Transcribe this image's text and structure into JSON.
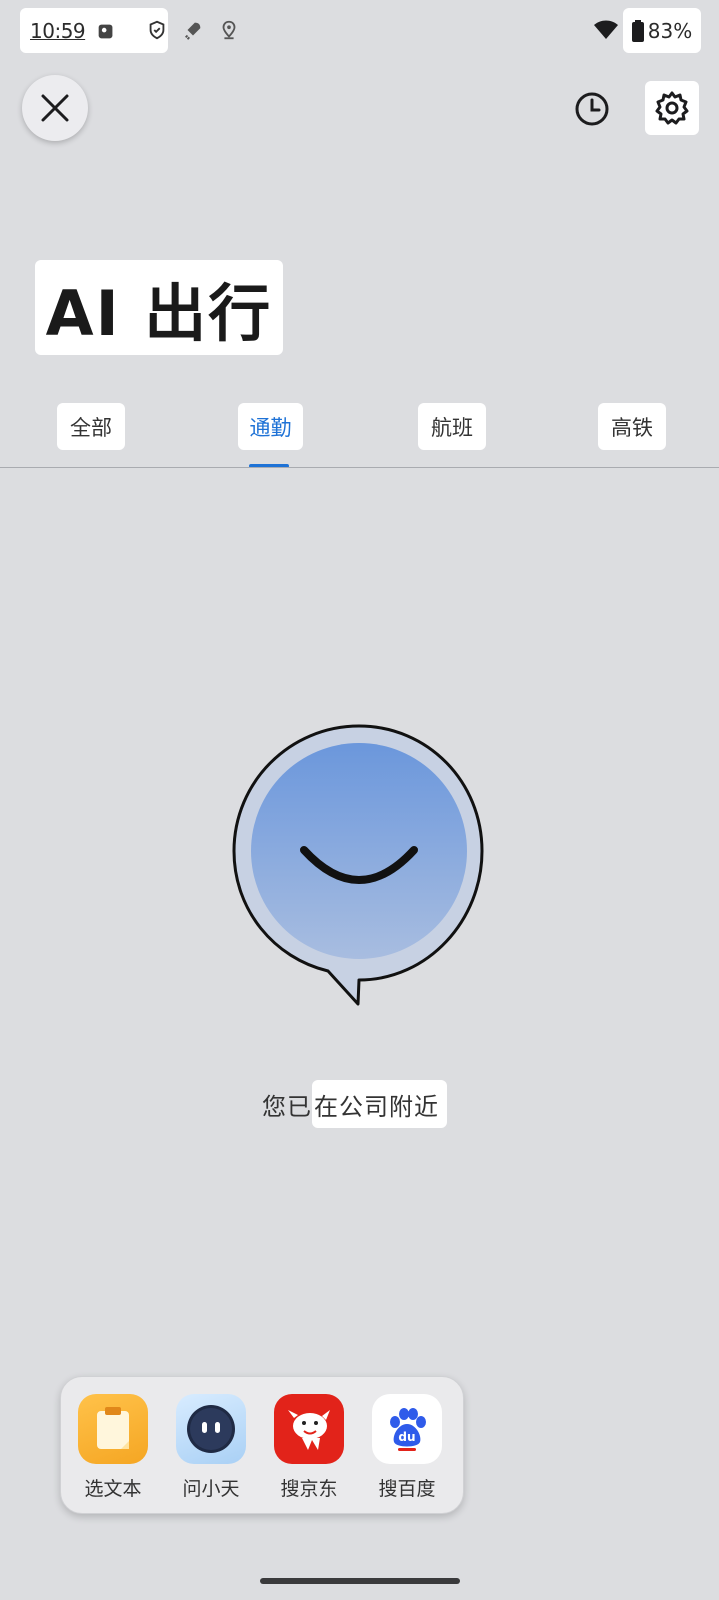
{
  "status_bar": {
    "time": "10:59",
    "battery": "83%"
  },
  "header": {
    "title": "AI 出行"
  },
  "tabs": [
    {
      "label": "全部",
      "active": false
    },
    {
      "label": "通勤",
      "active": true
    },
    {
      "label": "航班",
      "active": false
    },
    {
      "label": "高铁",
      "active": false
    }
  ],
  "status_message": {
    "part1": "您已",
    "part2": "在公司附近"
  },
  "dock": {
    "items": [
      {
        "label": "选文本",
        "icon": "clipboard-icon"
      },
      {
        "label": "问小天",
        "icon": "assistant-robot-icon"
      },
      {
        "label": "搜京东",
        "icon": "jd-dog-icon"
      },
      {
        "label": "搜百度",
        "icon": "baidu-paw-icon"
      }
    ]
  },
  "colors": {
    "accent": "#1e72d6",
    "background": "#dcdde0"
  }
}
